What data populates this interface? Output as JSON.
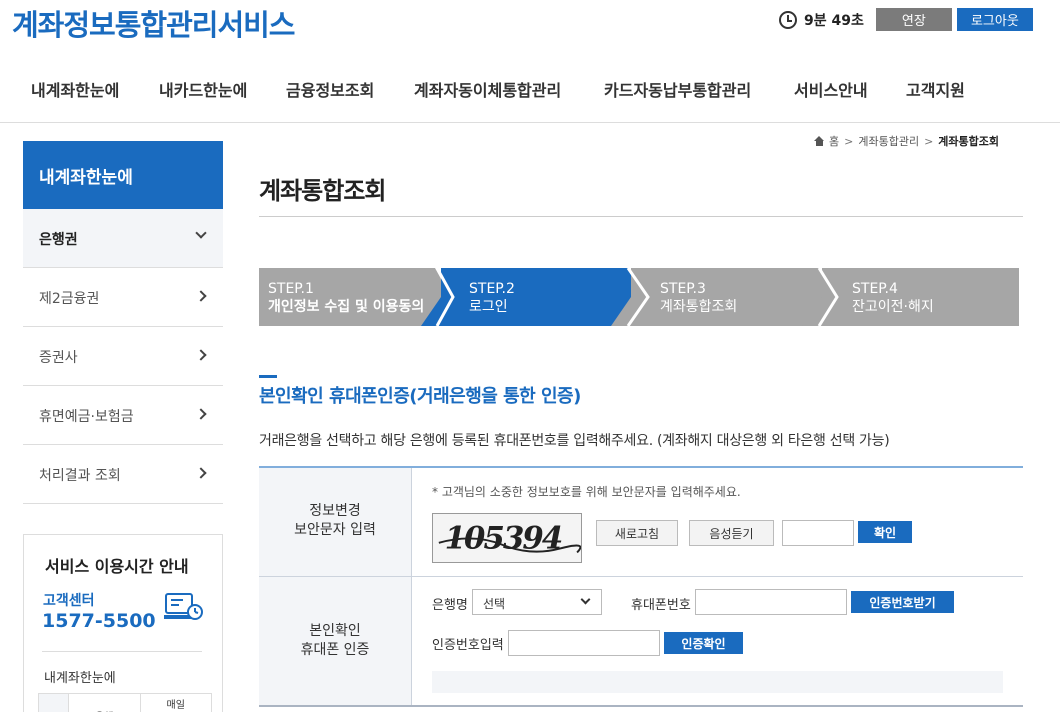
{
  "header": {
    "logo": "계좌정보통합관리서비스",
    "timer": "9분 49초",
    "extend_label": "연장",
    "logout_label": "로그아웃"
  },
  "gnb": [
    "내계좌한눈에",
    "내카드한눈에",
    "금융정보조회",
    "계좌자동이체통합관리",
    "카드자동납부통합관리",
    "서비스안내",
    "고객지원"
  ],
  "sidebar": {
    "title": "내계좌한눈에",
    "items": [
      {
        "label": "은행권",
        "active": true
      },
      {
        "label": "제2금융권"
      },
      {
        "label": "증권사"
      },
      {
        "label": "휴면예금·보험금"
      },
      {
        "label": "처리결과 조회"
      }
    ],
    "service_box": {
      "title": "서비스 이용시간 안내",
      "center_label": "고객센터",
      "phone": "1577-5500",
      "sub_title": "내계좌한눈에",
      "table_headers": [
        "",
        "은행",
        "매일"
      ]
    }
  },
  "breadcrumb": {
    "items": [
      "홈",
      "계좌통합관리",
      "계좌통합조회"
    ]
  },
  "main": {
    "title": "계좌통합조회",
    "steps": [
      {
        "num": "STEP.1",
        "label": "개인정보 수집 및 이용동의",
        "active": false
      },
      {
        "num": "STEP.2",
        "label": "로그인",
        "active": true
      },
      {
        "num": "STEP.3",
        "label": "계좌통합조회",
        "active": false
      },
      {
        "num": "STEP.4",
        "label": "잔고이전·해지",
        "active": false
      }
    ],
    "section_title": "본인확인 휴대폰인증(거래은행을 통한 인증)",
    "section_desc": "거래은행을 선택하고 해당 은행에 등록된 휴대폰번호를 입력해주세요. (계좌해지 대상은행 외 타은행 선택 가능)",
    "row1": {
      "label_line1": "정보변경",
      "label_line2": "보안문자 입력",
      "notice": "* 고객님의 소중한 정보보호를 위해 보안문자를 입력해주세요.",
      "captcha_text": "105394",
      "refresh_label": "새로고침",
      "audio_label": "음성듣기",
      "confirm_label": "확인"
    },
    "row2": {
      "label_line1": "본인확인",
      "label_line2": "휴대폰 인증",
      "bank_label": "은행명",
      "bank_selected": "선택",
      "phone_label": "휴대폰번호",
      "request_label": "인증번호받기",
      "code_label": "인증번호입력",
      "verify_label": "인증확인"
    }
  },
  "colors": {
    "primary": "#1a6bbf",
    "step_inactive": "#a6a6a6",
    "step_active": "#1a6bbf",
    "sidebar_active_bg": "#f3f5f8"
  }
}
